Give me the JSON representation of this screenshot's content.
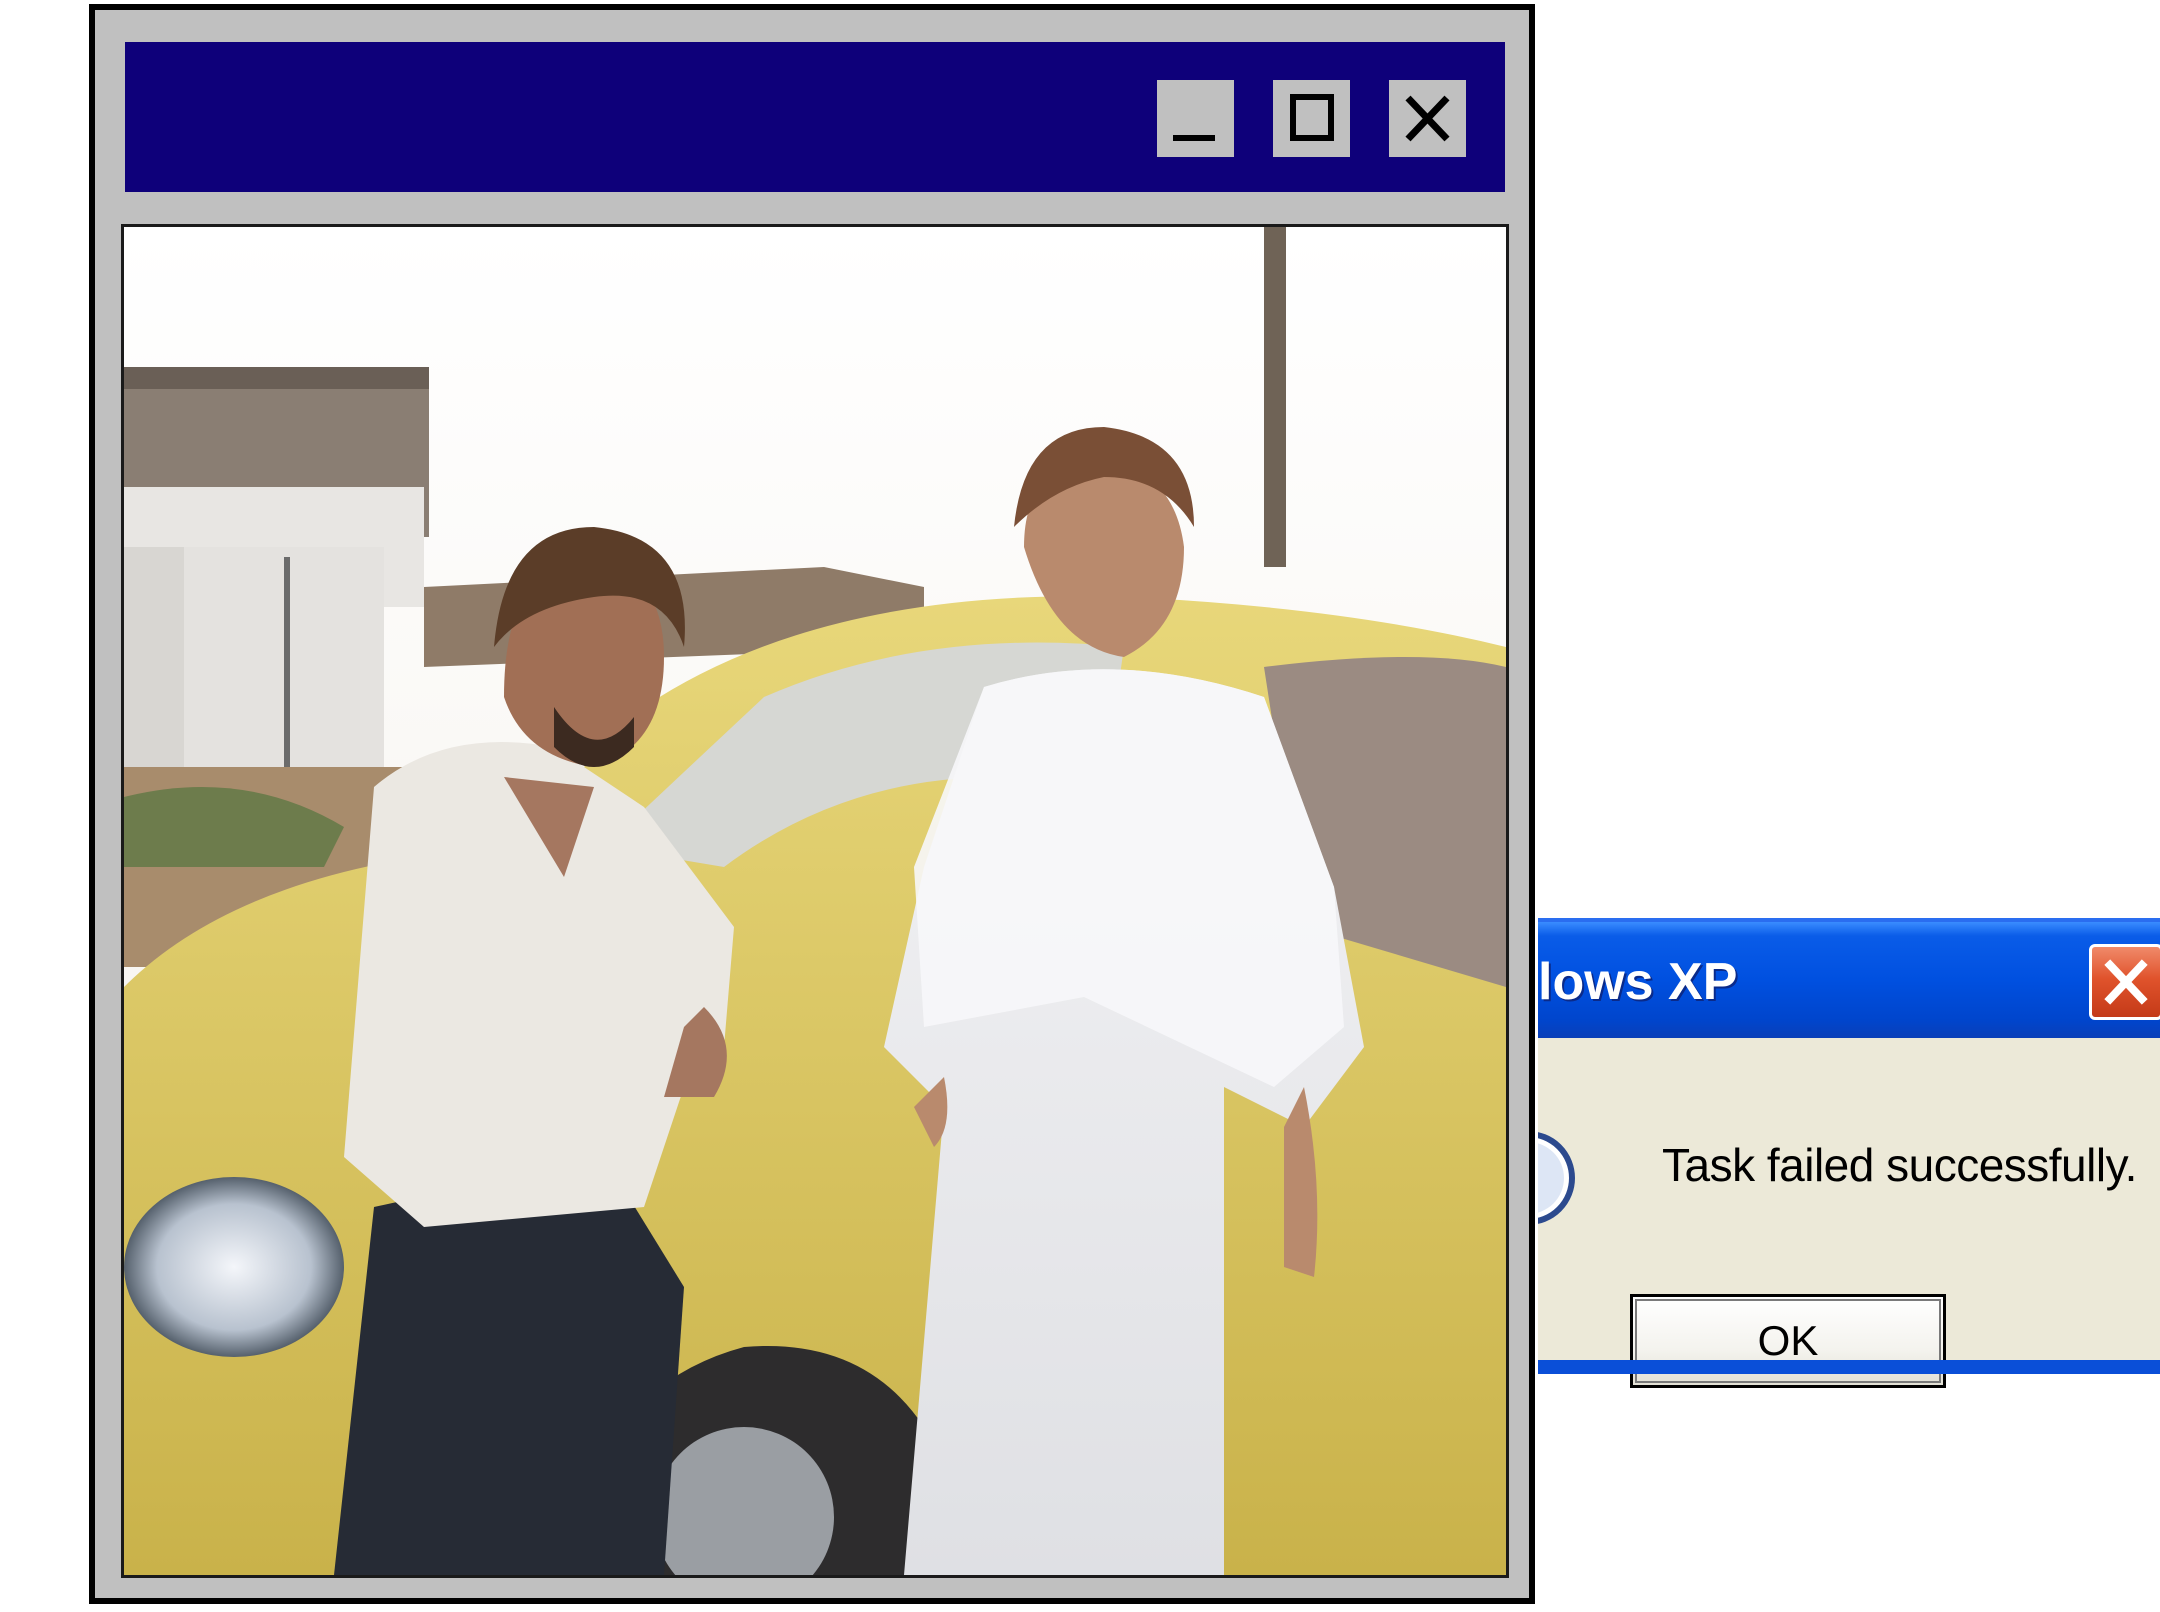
{
  "retro_window": {
    "titlebar_color": "#0e007a",
    "frame_color": "#c0c0c0",
    "controls": {
      "minimize_icon": "minimize-icon",
      "maximize_icon": "maximize-icon",
      "close_icon": "close-icon"
    }
  },
  "photo": {
    "subject": "photo-man-woman-yellow-car"
  },
  "dialog": {
    "title": "lows XP",
    "message": "Task failed successfully.",
    "ok_label": "OK",
    "titlebar_color": "#0050e0",
    "body_color": "#ece9d8",
    "close_icon": "close-icon",
    "info_icon": "info-icon"
  }
}
